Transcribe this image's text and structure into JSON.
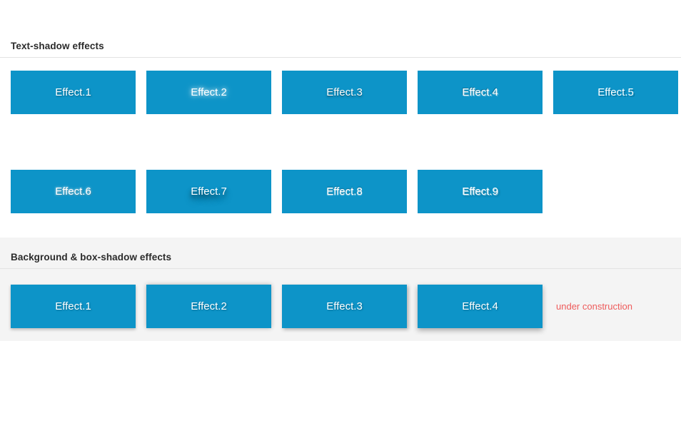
{
  "page": {
    "background_color": "#ffffff",
    "accent_color": "#0d94c8",
    "heading_color": "#2b2b2b",
    "note_color": "#ee5b5b",
    "gray_section_color": "#f4f4f4"
  },
  "sections": [
    {
      "id": "text-shadow",
      "heading": "Text-shadow effects",
      "rows": [
        {
          "id": "text-shadow-row-1",
          "boxes": [
            {
              "label": "Effect.1"
            },
            {
              "label": "Effect.2"
            },
            {
              "label": "Effect.3"
            },
            {
              "label": "Effect.4"
            },
            {
              "label": "Effect.5"
            }
          ]
        },
        {
          "id": "text-shadow-row-2",
          "boxes": [
            {
              "label": "Effect.6"
            },
            {
              "label": "Effect.7"
            },
            {
              "label": "Effect.8"
            },
            {
              "label": "Effect.9"
            }
          ]
        }
      ]
    },
    {
      "id": "background-box-shadow",
      "heading": "Background & box-shadow effects",
      "rows": [
        {
          "id": "box-shadow-row-1",
          "boxes": [
            {
              "label": "Effect.1"
            },
            {
              "label": "Effect.2"
            },
            {
              "label": "Effect.3"
            },
            {
              "label": "Effect.4"
            }
          ],
          "note": "under construction"
        }
      ]
    }
  ]
}
